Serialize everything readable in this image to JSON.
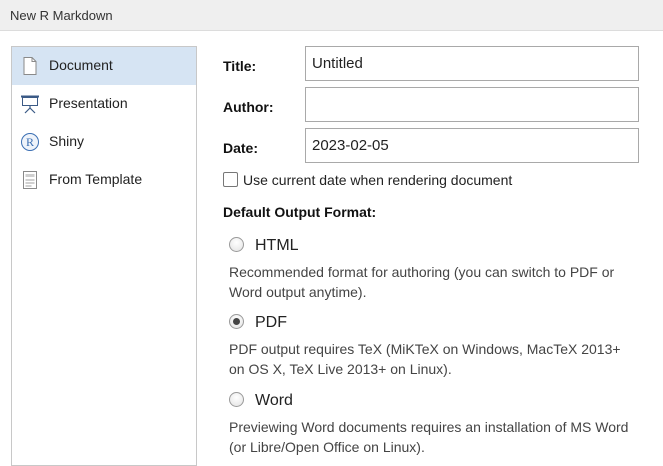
{
  "window": {
    "title": "New R Markdown"
  },
  "sidebar": {
    "items": [
      {
        "label": "Document",
        "icon": "document-icon",
        "selected": true
      },
      {
        "label": "Presentation",
        "icon": "presentation-icon",
        "selected": false
      },
      {
        "label": "Shiny",
        "icon": "shiny-r-icon",
        "selected": false
      },
      {
        "label": "From Template",
        "icon": "template-icon",
        "selected": false
      }
    ]
  },
  "form": {
    "title_label": "Title:",
    "title_value": "Untitled",
    "author_label": "Author:",
    "author_value": "",
    "date_label": "Date:",
    "date_value": "2023-02-05",
    "use_current_date_label": "Use current date when rendering document",
    "use_current_date_checked": false
  },
  "output_format": {
    "label": "Default Output Format:",
    "selected": "PDF",
    "options": [
      {
        "label": "HTML",
        "description": "Recommended format for authoring (you can switch to PDF or Word output anytime).",
        "checked": false
      },
      {
        "label": "PDF",
        "description": "PDF output requires TeX (MiKTeX on Windows, MacTeX 2013+ on OS X, TeX Live 2013+ on Linux).",
        "checked": true
      },
      {
        "label": "Word",
        "description": "Previewing Word documents requires an installation of MS Word (or Libre/Open Office on Linux).",
        "checked": false
      }
    ]
  },
  "colors": {
    "selected_item_bg": "#d6e4f3",
    "titlebar_bg": "#efefef",
    "border": "#c8c8c8",
    "shiny_blue": "#3b6fb3"
  }
}
